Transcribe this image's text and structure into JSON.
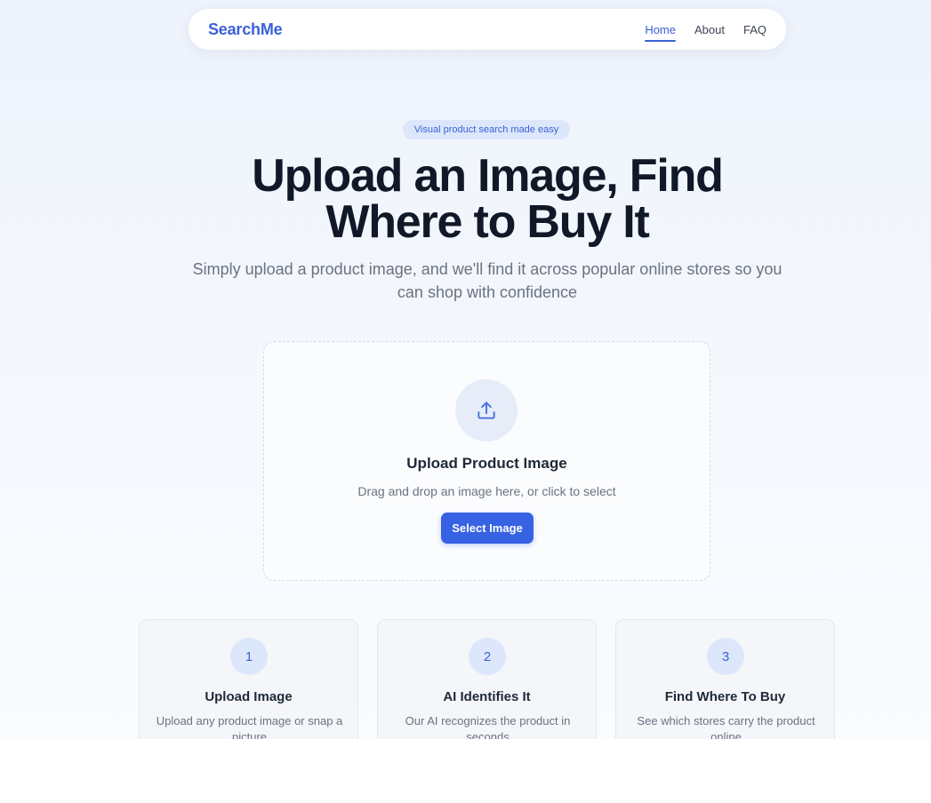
{
  "nav": {
    "brand": "SearchMe",
    "links": [
      {
        "label": "Home",
        "active": true
      },
      {
        "label": "About",
        "active": false
      },
      {
        "label": "FAQ",
        "active": false
      }
    ]
  },
  "hero": {
    "badge": "Visual product search made easy",
    "title_line1": "Upload an Image, Find",
    "title_line2": "Where to Buy It",
    "subtitle": "Simply upload a product image, and we'll find it across popular online stores so you can shop with confidence"
  },
  "upload": {
    "icon": "upload-icon",
    "heading": "Upload Product Image",
    "hint": "Drag and drop an image here, or click to select",
    "button_label": "Select Image"
  },
  "steps": [
    {
      "number": "1",
      "title": "Upload Image",
      "description": "Upload any product image or snap a picture"
    },
    {
      "number": "2",
      "title": "AI Identifies It",
      "description": "Our AI recognizes the product in seconds"
    },
    {
      "number": "3",
      "title": "Find Where To Buy",
      "description": "See which stores carry the product online"
    }
  ],
  "colors": {
    "accent": "#3a62d6",
    "button": "#3662e3",
    "heading": "#111827",
    "muted": "#6b7280"
  }
}
